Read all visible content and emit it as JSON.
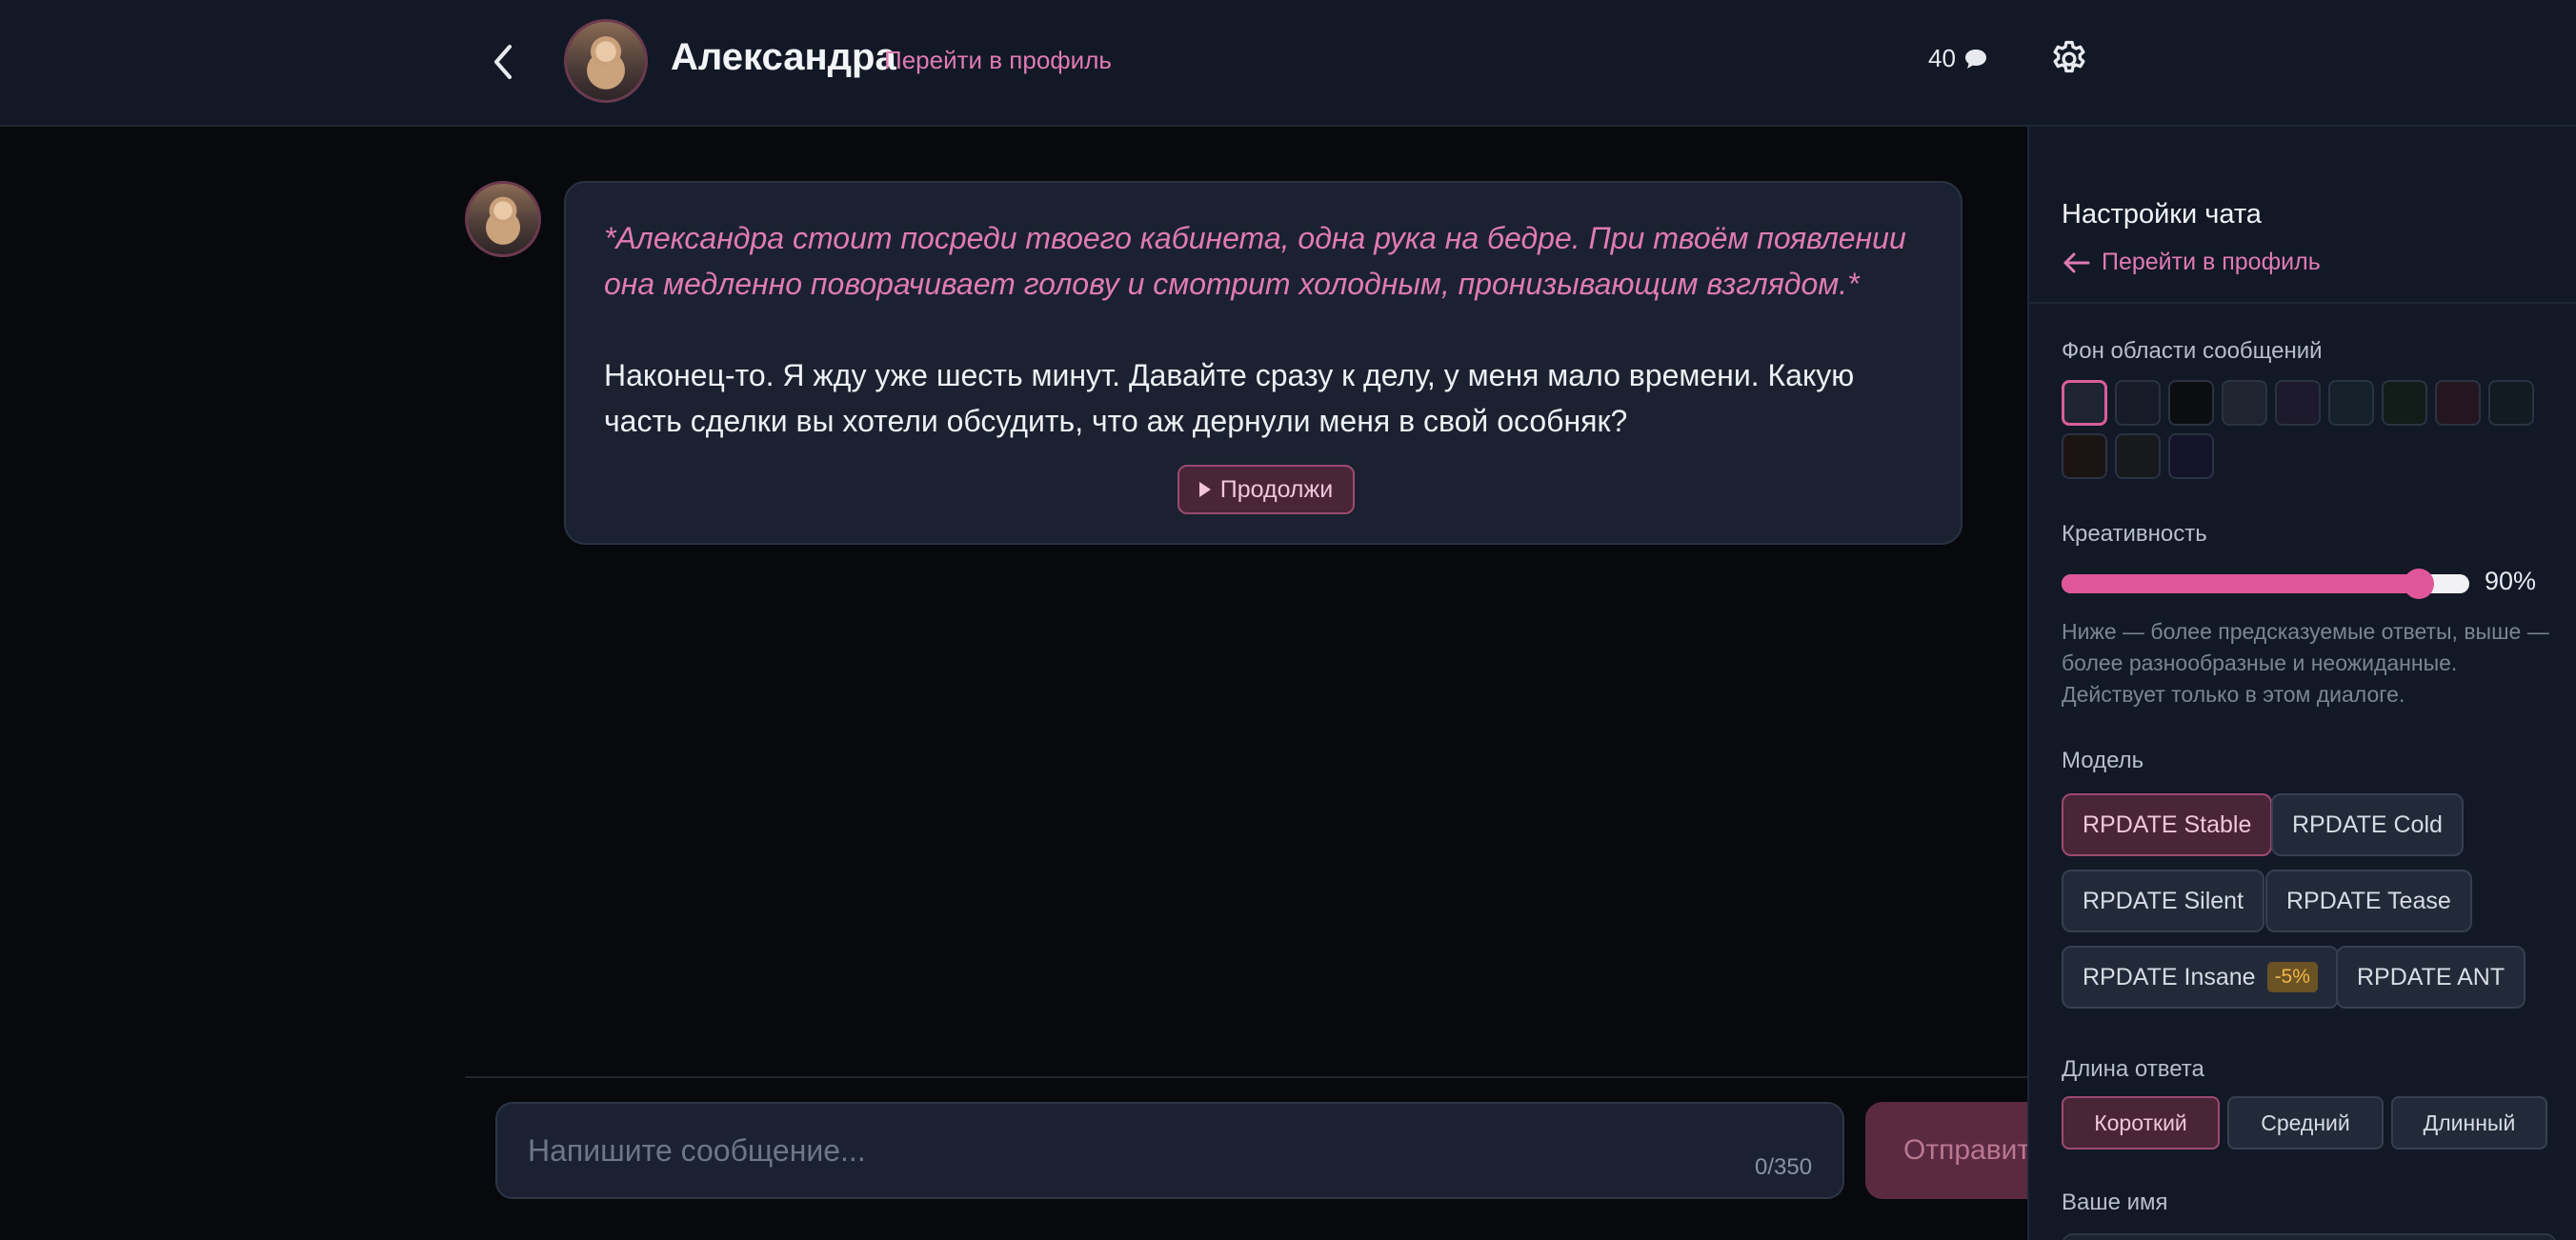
{
  "header": {
    "character_name": "Александра",
    "profile_link": "Перейти в профиль",
    "message_count": "40",
    "icons": {
      "back": "chevron-left-icon",
      "chat": "chat-bubble-icon",
      "settings": "gear-icon"
    }
  },
  "messages": [
    {
      "author": "Александра",
      "action": "*Александра стоит посреди твоего кабинета, одна рука на бедре. При твоём появлении она медленно поворачивает голову и смотрит холодным, пронизывающим взглядом.*",
      "text": "Наконец-то. Я жду уже шесть минут. Давайте сразу к делу, у меня мало времени. Какую часть сделки вы хотели обсудить, что аж дернули меня в свой особняк?",
      "continue_label": "Продолжи"
    }
  ],
  "composer": {
    "placeholder": "Напишите сообщение...",
    "value": "",
    "counter": "0/350",
    "send_label": "Отправить"
  },
  "settings": {
    "title": "Настройки чата",
    "profile_link": "Перейти в профиль",
    "background": {
      "label": "Фон области сообщений",
      "selected_index": 0,
      "colors": [
        "#1f2433",
        "#161b27",
        "#0c0d10",
        "#1f2430",
        "#1c1a2c",
        "#14202a",
        "#121c19",
        "#231620",
        "#121a22",
        "#1c1412",
        "#17191c",
        "#15142a"
      ]
    },
    "creativity": {
      "label": "Креативность",
      "value": 90,
      "value_label": "90%",
      "hint": "Ниже — более предсказуемые ответы, выше — более разнообразные и неожиданные. Действует только в этом диалоге."
    },
    "model": {
      "label": "Модель",
      "options": [
        {
          "name": "RPDATE Stable",
          "active": true
        },
        {
          "name": "RPDATE Cold",
          "active": false
        },
        {
          "name": "RPDATE Silent",
          "active": false
        },
        {
          "name": "RPDATE Tease",
          "active": false
        },
        {
          "name": "RPDATE Insane",
          "active": false,
          "badge": "-5%"
        },
        {
          "name": "RPDATE ANT",
          "active": false
        }
      ]
    },
    "length": {
      "label": "Длина ответа",
      "options": [
        {
          "name": "Короткий",
          "active": true
        },
        {
          "name": "Средний",
          "active": false
        },
        {
          "name": "Длинный",
          "active": false
        }
      ]
    },
    "your_name": {
      "label": "Ваше имя"
    }
  },
  "colors": {
    "accent": "#e07bb4",
    "accent_strong": "#e0569a",
    "panel_bg": "#121826",
    "bubble_bg": "#1b2130",
    "page_bg": "#08090c"
  }
}
